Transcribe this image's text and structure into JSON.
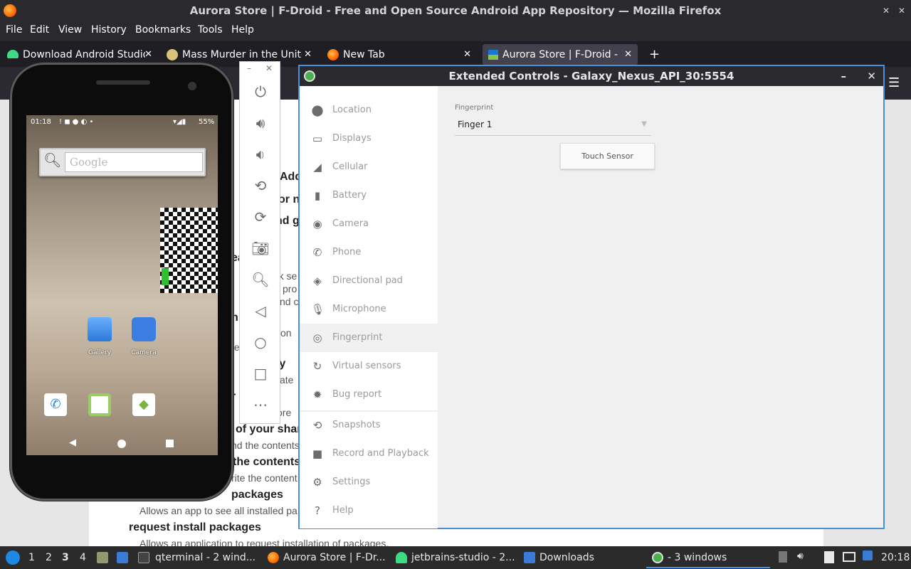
{
  "window": {
    "title": "Aurora Store | F-Droid - Free and Open Source Android App Repository — Mozilla Firefox"
  },
  "menu": [
    "File",
    "Edit",
    "View",
    "History",
    "Bookmarks",
    "Tools",
    "Help"
  ],
  "tabs": [
    {
      "label": "Download Android Studio"
    },
    {
      "label": "Mass Murder in the United"
    },
    {
      "label": "New Tab"
    },
    {
      "label": "Aurora Store | F-Droid - Fr"
    }
  ],
  "page": {
    "lines": [
      {
        "text": "Add",
        "kind": "h"
      },
      {
        "text": "or n",
        "kind": "h"
      },
      {
        "text": "nd g",
        "kind": "h"
      },
      {
        "text": "ea",
        "kind": "h"
      },
      {
        "text": "rk se",
        "kind": "s"
      },
      {
        "text": "pro",
        "kind": "s"
      },
      {
        "text": "nd c",
        "kind": "s"
      },
      {
        "text": "n",
        "kind": "h"
      },
      {
        "text": "tion",
        "kind": "s"
      },
      {
        "text": "te",
        "kind": "s"
      },
      {
        "text": "ty",
        "kind": "h"
      },
      {
        "text": "ate",
        "kind": "s"
      },
      {
        "text": "r",
        "kind": "h"
      },
      {
        "text": "ore",
        "kind": "s"
      },
      {
        "text": "of your shar",
        "kind": "h"
      },
      {
        "text": "nd the contents",
        "kind": "s"
      },
      {
        "text": "the contents",
        "kind": "h"
      },
      {
        "text": "rite the content",
        "kind": "s"
      },
      {
        "text": "packages",
        "kind": "h"
      },
      {
        "text": "Allows an app to see all installed pa",
        "kind": "s"
      },
      {
        "text": "request install packages",
        "kind": "h"
      },
      {
        "text": "Allows an application to request installation of packages.",
        "kind": "s"
      }
    ]
  },
  "phone": {
    "time": "01:18",
    "battery": "55%",
    "search_placeholder": "Google",
    "apps": [
      {
        "label": "Gallery"
      },
      {
        "label": "Camera"
      }
    ]
  },
  "ext": {
    "title": "Extended Controls - Galaxy_Nexus_API_30:5554",
    "sidebar": [
      {
        "label": "Location",
        "icon": "location-icon"
      },
      {
        "label": "Displays",
        "icon": "displays-icon"
      },
      {
        "label": "Cellular",
        "icon": "cellular-icon"
      },
      {
        "label": "Battery",
        "icon": "battery-icon"
      },
      {
        "label": "Camera",
        "icon": "camera-icon"
      },
      {
        "label": "Phone",
        "icon": "phone-icon"
      },
      {
        "label": "Directional pad",
        "icon": "dpad-icon"
      },
      {
        "label": "Microphone",
        "icon": "microphone-icon"
      },
      {
        "label": "Fingerprint",
        "icon": "fingerprint-icon"
      },
      {
        "label": "Virtual sensors",
        "icon": "sensors-icon"
      },
      {
        "label": "Bug report",
        "icon": "bug-icon"
      },
      {
        "label": "Snapshots",
        "icon": "snapshots-icon"
      },
      {
        "label": "Record and Playback",
        "icon": "record-icon"
      },
      {
        "label": "Settings",
        "icon": "settings-icon"
      },
      {
        "label": "Help",
        "icon": "help-icon"
      }
    ],
    "selected": "Fingerprint",
    "fingerprint_label": "Fingerprint",
    "fingerprint_value": "Finger 1",
    "touch_label": "Touch Sensor"
  },
  "taskbar": {
    "workspaces": [
      "1",
      "2",
      "3",
      "4"
    ],
    "items": [
      {
        "label": "qterminal - 2 wind..."
      },
      {
        "label": "Aurora Store | F-Dr..."
      },
      {
        "label": "jetbrains-studio - 2..."
      },
      {
        "label": "Downloads"
      },
      {
        "label": "- 3 windows"
      }
    ],
    "clock": "20:18"
  },
  "colors": {
    "accent": "#4a90d9",
    "page_bg": "#ffffff",
    "titlebar": "#2b2b2f"
  }
}
